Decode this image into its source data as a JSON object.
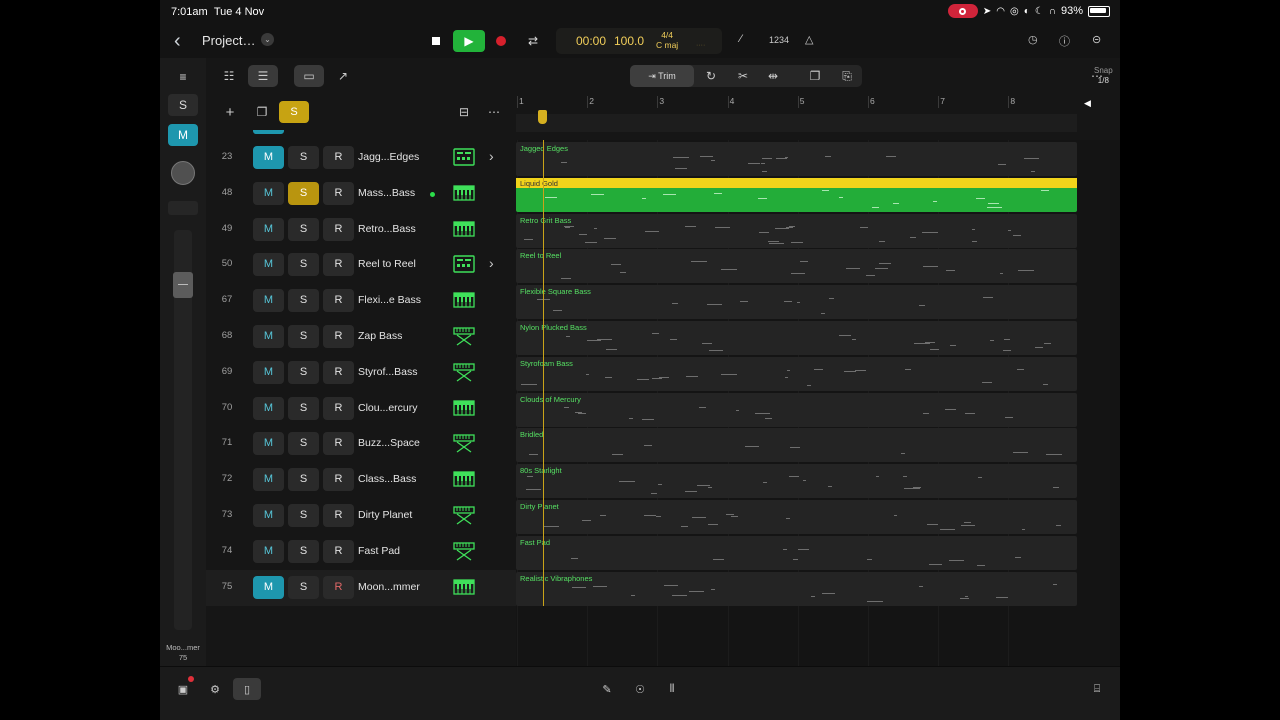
{
  "status": {
    "time": "7:01am",
    "date": "Tue 4 Nov",
    "battery": "93%"
  },
  "header": {
    "project_title": "Project…",
    "lcd": {
      "position": "00:00",
      "tempo": "100.0",
      "time_signature": "4/4",
      "key": "C maj",
      "extra": "····"
    },
    "count_in_label": "1234"
  },
  "toolbar": {
    "trim_label": "Trim",
    "snap_label": "Snap",
    "snap_value": "1/8"
  },
  "track_header": {
    "solo_label": "S"
  },
  "left_rail": {
    "solo_label": "S",
    "mute_label": "M",
    "selected_track_name": "Moo...mer",
    "selected_track_number": "75"
  },
  "ruler": {
    "bars": [
      "1",
      "2",
      "3",
      "4",
      "5",
      "6",
      "7",
      "8"
    ]
  },
  "button_labels": {
    "mute": "M",
    "solo": "S",
    "record": "R"
  },
  "tracks": [
    {
      "number": "23",
      "name": "Jagg...Edges",
      "region": "Jagged Edges",
      "mute_on": true,
      "solo_on": false,
      "icon": "drum-machine-icon",
      "chevron": true
    },
    {
      "number": "48",
      "name": "Mass...Bass",
      "region": "Liquid Gold",
      "mute_on": false,
      "solo_on": true,
      "icon": "keyboard-icon",
      "selected_region": true,
      "activity": true
    },
    {
      "number": "49",
      "name": "Retro...Bass",
      "region": "Retro Grit Bass",
      "mute_on": false,
      "solo_on": false,
      "icon": "keyboard-icon"
    },
    {
      "number": "50",
      "name": "Reel to Reel",
      "region": "Reel to Reel",
      "mute_on": false,
      "solo_on": false,
      "icon": "drum-machine-icon",
      "chevron": true
    },
    {
      "number": "67",
      "name": "Flexi...e Bass",
      "region": "Flexible Square Bass",
      "mute_on": false,
      "solo_on": false,
      "icon": "keyboard-icon"
    },
    {
      "number": "68",
      "name": "Zap Bass",
      "region": "Nylon Plucked Bass",
      "mute_on": false,
      "solo_on": false,
      "icon": "keyboard-stand-icon"
    },
    {
      "number": "69",
      "name": "Styrof...Bass",
      "region": "Styrofoam Bass",
      "mute_on": false,
      "solo_on": false,
      "icon": "keyboard-stand-icon"
    },
    {
      "number": "70",
      "name": "Clou...ercury",
      "region": "Clouds of Mercury",
      "mute_on": false,
      "solo_on": false,
      "icon": "keyboard-icon"
    },
    {
      "number": "71",
      "name": "Buzz...Space",
      "region": "Bridled",
      "mute_on": false,
      "solo_on": false,
      "icon": "keyboard-stand-icon"
    },
    {
      "number": "72",
      "name": "Class...Bass",
      "region": "80s Starlight",
      "mute_on": false,
      "solo_on": false,
      "icon": "keyboard-icon"
    },
    {
      "number": "73",
      "name": "Dirty Planet",
      "region": "Dirty Planet",
      "mute_on": false,
      "solo_on": false,
      "icon": "keyboard-stand-icon"
    },
    {
      "number": "74",
      "name": "Fast Pad",
      "region": "Fast Pad",
      "mute_on": false,
      "solo_on": false,
      "icon": "keyboard-stand-icon"
    },
    {
      "number": "75",
      "name": "Moon...mmer",
      "region": "Realistic Vibraphones",
      "mute_on": true,
      "solo_on": false,
      "icon": "keyboard-icon",
      "record_armed": true
    }
  ],
  "colors": {
    "accent_mute": "#1e97ae",
    "accent_solo": "#b9950f",
    "play": "#22b33a",
    "record": "#d6202c",
    "region_text": "#56e063",
    "selected_region": "#23ad39",
    "selected_region_header": "#f1d41b",
    "playhead": "#c9a318"
  }
}
